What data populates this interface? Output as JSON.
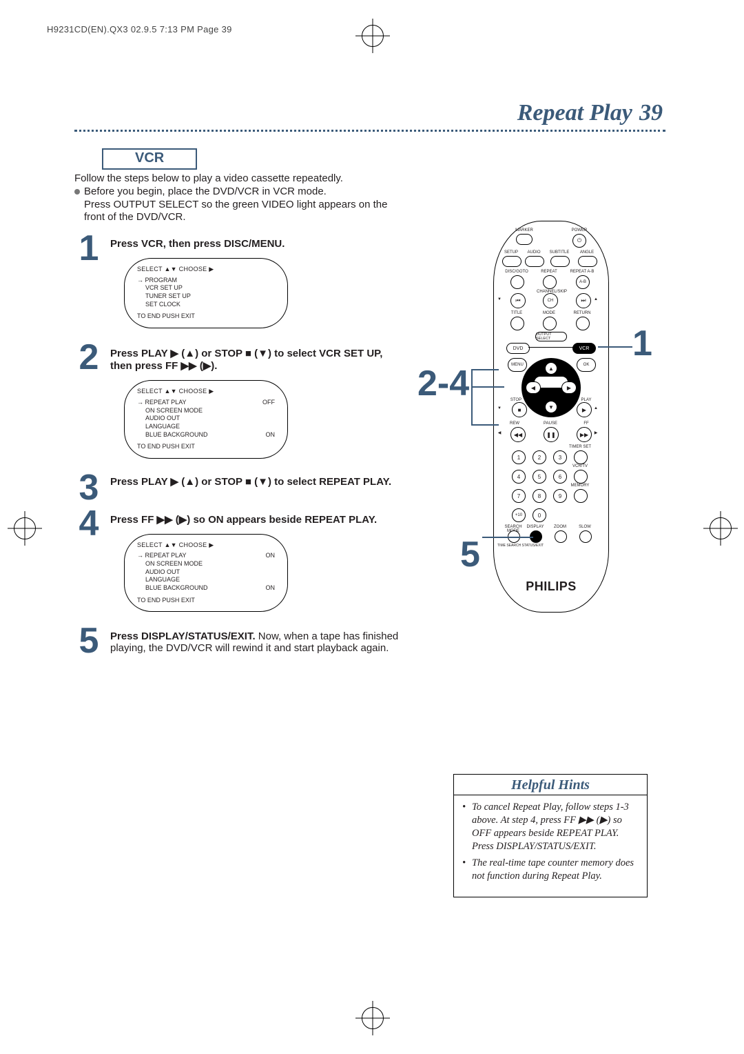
{
  "color_accent": "#3b5a79",
  "header_note": "H9231CD(EN).QX3  02.9.5 7:13 PM  Page 39",
  "title": "Repeat Play",
  "page_number": "39",
  "mode_label": "VCR",
  "intro": {
    "line1": "Follow the steps below to play a video cassette repeatedly.",
    "bullet_line1": "Before you begin, place the DVD/VCR in VCR mode.",
    "bullet_line2": "Press OUTPUT SELECT so the green VIDEO light appears on the front of the DVD/VCR."
  },
  "steps": [
    {
      "n": "1",
      "body_parts": [
        "Press VCR, then press DISC/MENU."
      ],
      "osd": {
        "head": "SELECT ▲▼ CHOOSE ▶",
        "leader": "→ PROGRAM",
        "lines": [
          {
            "l": "VCR SET UP",
            "r": ""
          },
          {
            "l": "TUNER SET UP",
            "r": ""
          },
          {
            "l": "SET CLOCK",
            "r": ""
          }
        ],
        "foot": "TO END PUSH EXIT"
      }
    },
    {
      "n": "2",
      "body_parts": [
        "Press PLAY ▶ (▲) or STOP ■ (▼) to select VCR SET UP, then press FF ▶▶ (▶)."
      ],
      "osd": {
        "head": "SELECT ▲▼ CHOOSE ▶",
        "leader": "→ REPEAT PLAY",
        "leader_r": "OFF",
        "lines": [
          {
            "l": "ON SCREEN MODE",
            "r": ""
          },
          {
            "l": "AUDIO OUT",
            "r": ""
          },
          {
            "l": "LANGUAGE",
            "r": ""
          },
          {
            "l": "BLUE BACKGROUND",
            "r": "ON"
          }
        ],
        "foot": "TO END PUSH EXIT"
      }
    },
    {
      "n": "3",
      "body_parts": [
        "Press PLAY ▶ (▲) or STOP ■ (▼) to select REPEAT PLAY."
      ]
    },
    {
      "n": "4",
      "body_parts": [
        "Press FF ▶▶ (▶) so ON appears beside REPEAT PLAY."
      ],
      "osd": {
        "head": "SELECT ▲▼ CHOOSE ▶",
        "leader": "→ REPEAT PLAY",
        "leader_r": "ON",
        "lines": [
          {
            "l": "ON SCREEN MODE",
            "r": ""
          },
          {
            "l": "AUDIO OUT",
            "r": ""
          },
          {
            "l": "LANGUAGE",
            "r": ""
          },
          {
            "l": "BLUE BACKGROUND",
            "r": "ON"
          }
        ],
        "foot": "TO END PUSH EXIT"
      }
    },
    {
      "n": "5",
      "body_strong": "Press DISPLAY/STATUS/EXIT.",
      "body_rest": " Now, when a tape has finished playing, the DVD/VCR will rewind it and start playback again."
    }
  ],
  "remote": {
    "brand": "PHILIPS",
    "top_labels": {
      "marker": "MARKER",
      "power": "POWER"
    },
    "row_labels": [
      "SETUP",
      "AUDIO",
      "SUBTITLE",
      "ANGLE"
    ],
    "row2_labels": [
      "DISC/GOTO",
      "REPEAT",
      "REPEAT A-B"
    ],
    "chskip": "CHANNEL/SKIP",
    "title": "TITLE",
    "mode": "MODE",
    "return": "RETURN",
    "output": "OUTPUT SELECT",
    "dvd": "DVD",
    "vcr": "VCR",
    "menu": "MENU",
    "ok": "OK",
    "stop": "STOP",
    "play": "PLAY",
    "rew": "REW",
    "pause": "PAUSE",
    "ff": "FF",
    "timerset": "TIMER SET",
    "vcrtv": "VCR/TV",
    "memory": "MEMORY",
    "bottom_small": [
      "SEARCH MODE",
      "DISPLAY",
      "ZOOM",
      "SLOW"
    ],
    "bottom_tiny": "TIME SEARCH  STATUS/EXIT"
  },
  "callouts": {
    "right_1": "1",
    "left_24": "2-4",
    "left_5": "5"
  },
  "hints": {
    "title": "Helpful Hints",
    "items": [
      "To cancel Repeat Play, follow steps 1-3 above. At step 4, press FF ▶▶ (▶) so OFF appears beside REPEAT PLAY. Press DISPLAY/STATUS/EXIT.",
      "The real-time tape counter memory does not function during Repeat Play."
    ]
  }
}
